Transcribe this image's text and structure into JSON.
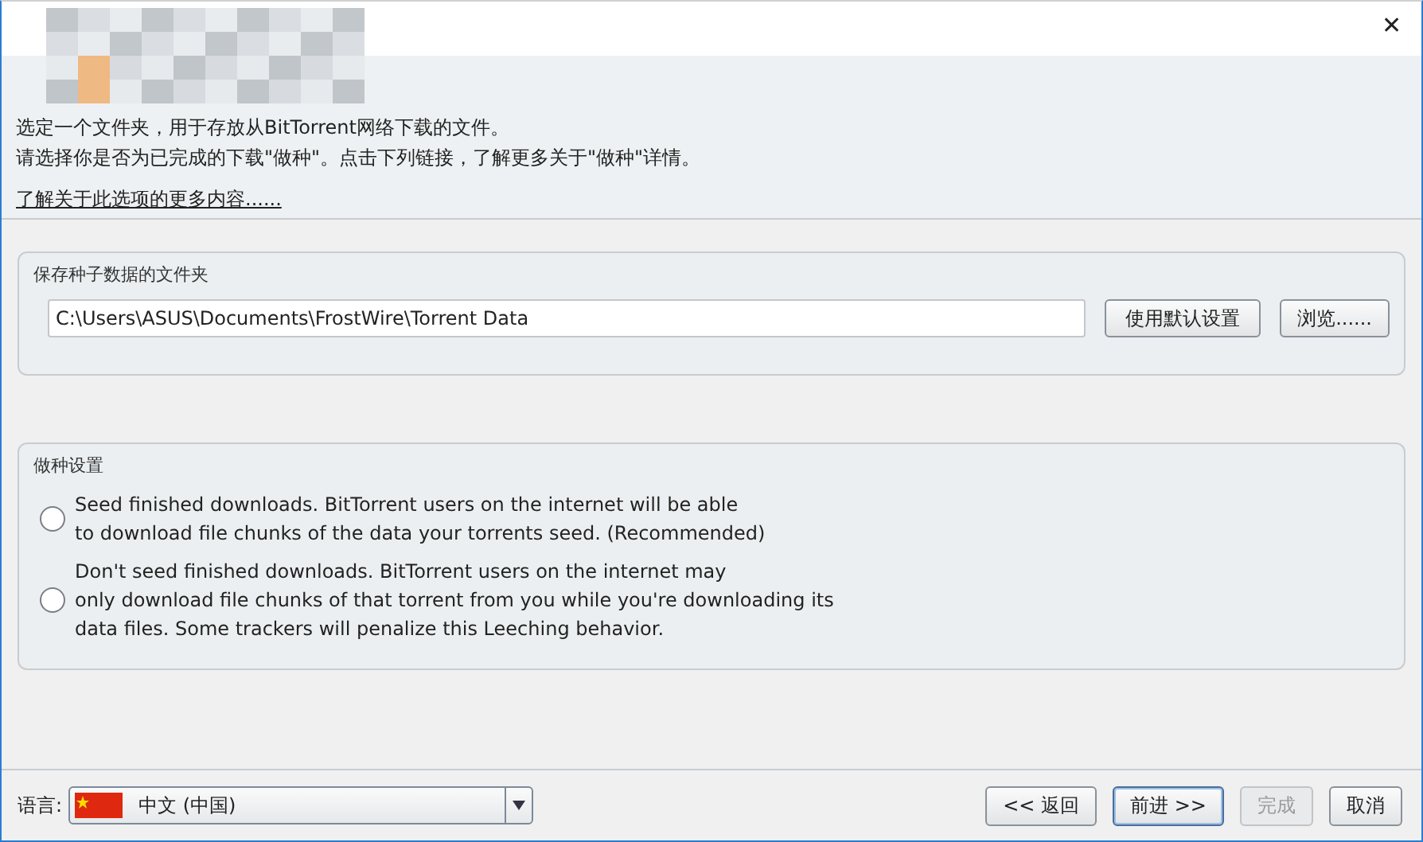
{
  "window": {
    "close": "✕"
  },
  "header": {
    "lines": [
      "选定一个文件夹，用于存放从BitTorrent网络下载的文件。",
      "请选择你是否为已完成的下载\"做种\"。点击下列链接，了解更多关于\"做种\"详情。"
    ],
    "link": "了解关于此选项的更多内容......"
  },
  "folder_panel": {
    "title": "保存种子数据的文件夹",
    "path": "C:\\Users\\ASUS\\Documents\\FrostWire\\Torrent Data",
    "buttons": [
      "使用默认设置",
      "浏览......"
    ]
  },
  "seed_panel": {
    "title": "做种设置",
    "options": [
      {
        "lines": [
          "Seed finished downloads. BitTorrent users on the internet will be able",
          "to download file chunks of the data your torrents seed. (Recommended)"
        ],
        "selected": false
      },
      {
        "lines": [
          "Don't seed finished downloads. BitTorrent users on the internet may",
          "only download file chunks of that torrent from you while you're downloading its",
          "data files. Some trackers will penalize this Leeching behavior."
        ],
        "selected": false
      }
    ]
  },
  "footer": {
    "language_label": "语言:",
    "language": "中文 (中国)",
    "buttons": [
      {
        "label": "<< 返回",
        "disabled": false,
        "selected": false
      },
      {
        "label": "前进 >>",
        "disabled": false,
        "selected": true
      },
      {
        "label": "完成",
        "disabled": true,
        "selected": false
      },
      {
        "label": "取消",
        "disabled": false,
        "selected": false
      }
    ]
  }
}
